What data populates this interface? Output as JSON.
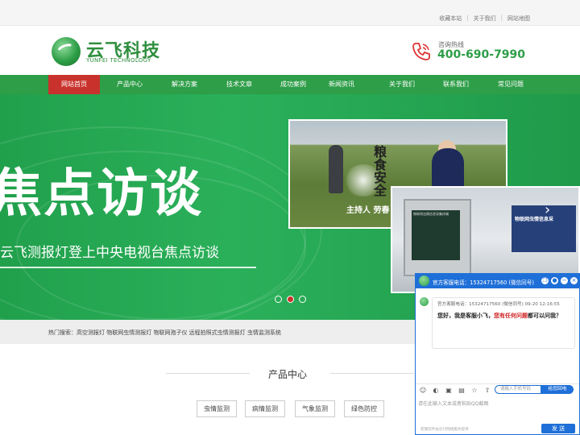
{
  "top_links": [
    "收藏本站",
    "关于我们",
    "网站地图"
  ],
  "top_sep": "|",
  "logo": {
    "cn": "云飞科技",
    "en": "YUNFEI TECHNOLOGY"
  },
  "hotline": {
    "label": "咨询热线",
    "number": "400-690-7990"
  },
  "nav": [
    "网站首页",
    "产品中心",
    "解决方案",
    "技术文章",
    "成功案例",
    "新闻资讯",
    "关于我们",
    "联系我们",
    "常见问题"
  ],
  "nav_active_index": 0,
  "banner": {
    "title": "焦点访谈",
    "subtitle": "云飞测报灯登上中央电视台焦点访谈",
    "photo1_calligraphy": "粮食安全",
    "photo1_caption": "主持人 劳春",
    "photo2_board": "物联网虫情信息采",
    "photo2_panel": "物联网虫情信息采集终端",
    "arrow": "›",
    "slides": 3,
    "active_slide": 1
  },
  "hot_search": "热门搜索：高空测报灯 物联网虫情测报灯 物联网孢子仪 远程拍照式虫情测报灯 虫情监测系统",
  "product_section": {
    "title": "产品中心",
    "categories": [
      "虫情监测",
      "病情监测",
      "气象监测",
      "绿色防控"
    ]
  },
  "chat": {
    "title": "官方客服电话：15324717560 (微信同号)",
    "controls": [
      "❐",
      "●",
      "−",
      "×"
    ],
    "msg_meta": "官方客服电话：15324717560 (微信同号) 09-20 12:16:55",
    "greet_a": "您好，我是客服小飞，",
    "greet_b": "您有任何问题",
    "greet_c": "都可以问我？",
    "tools": [
      "☺",
      "◐",
      "▣",
      "▤",
      "☆",
      "⇧"
    ],
    "phone_placeholder": "请输入手机号码",
    "callback_label": "给您回电",
    "textarea_placeholder": "请在此输入文本或者粘贴QQ截图",
    "footer_note": "客服软件由云付网络服务提供",
    "send_label": "发 送"
  },
  "colors": {
    "brand_green": "#2e9e48",
    "active_red": "#c9322c",
    "chat_blue": "#1f6fd8"
  }
}
